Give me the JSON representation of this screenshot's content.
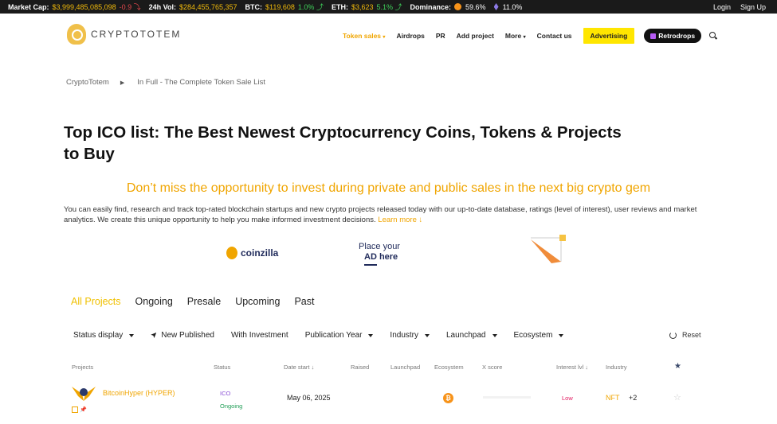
{
  "ticker": {
    "market_cap_label": "Market Cap:",
    "market_cap_value": "$3,999,485,085,098",
    "market_cap_change": "-0.9",
    "vol_label": "24h Vol:",
    "vol_value": "$284,455,765,357",
    "btc_label": "BTC:",
    "btc_value": "$119,608",
    "btc_change": "1.0%",
    "eth_label": "ETH:",
    "eth_value": "$3,623",
    "eth_change": "5.1%",
    "dominance_label": "Dominance:",
    "btc_dominance": "59.6%",
    "eth_dominance": "11.0%",
    "login": "Login",
    "signup": "Sign Up"
  },
  "header": {
    "logo_text": "CRYPTOTOTEM",
    "nav": {
      "token_sales": "Token sales",
      "airdrops": "Airdrops",
      "pr": "PR",
      "add_project": "Add project",
      "more": "More",
      "contact": "Contact us",
      "advertising": "Advertising",
      "retrodrops": "Retrodrops"
    }
  },
  "breadcrumb": {
    "home": "CryptoTotem",
    "current": "In Full - The Complete Token Sale List"
  },
  "page": {
    "title": "Top ICO list: The Best Newest Cryptocurrency Coins, Tokens & Projects to Buy",
    "tagline": "Don’t miss the opportunity to invest during private and public sales in the next big crypto gem",
    "intro": "You can easily find, research and track top-rated blockchain startups and new crypto projects released today with our up-to-date database, ratings (level of interest), user reviews and market analytics. We create this unique opportunity to help you make informed investment decisions.",
    "learn_more": "Learn more ↓"
  },
  "ads": {
    "coinzilla": "coinzilla",
    "place_line1": "Place your",
    "place_line2": "AD here"
  },
  "tabs": [
    "All Projects",
    "Ongoing",
    "Presale",
    "Upcoming",
    "Past"
  ],
  "filters": {
    "status_display": "Status display",
    "new_published": "New Published",
    "with_investment": "With Investment",
    "publication_year": "Publication Year",
    "industry": "Industry",
    "launchpad": "Launchpad",
    "ecosystem": "Ecosystem",
    "reset": "Reset"
  },
  "table": {
    "headers": {
      "projects": "Projects",
      "status": "Status",
      "date_start": "Date start ↓",
      "raised": "Raised",
      "launchpad": "Launchpad",
      "ecosystem": "Ecosystem",
      "xscore": "X score",
      "interest": "Interest lvl ↓",
      "industry": "Industry",
      "star": "★"
    },
    "rows": [
      {
        "name": "BitcoinHyper (HYPER)",
        "status_type": "ICO",
        "status_state": "Ongoing",
        "date": "May 06, 2025",
        "ecosystem_icon": "bitcoin-icon",
        "interest": "Low",
        "industry": "NFT",
        "industry_more": "+2"
      }
    ]
  },
  "colors": {
    "accent": "#f0a500",
    "advertising_bg": "#ffe600",
    "dark": "#1a1a1a"
  }
}
